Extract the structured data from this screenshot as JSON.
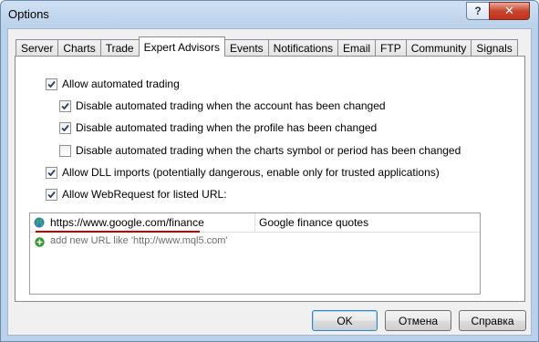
{
  "window": {
    "title": "Options",
    "help_label": "?",
    "close_label": "✕"
  },
  "tabs": [
    {
      "label": "Server"
    },
    {
      "label": "Charts"
    },
    {
      "label": "Trade"
    },
    {
      "label": "Expert Advisors",
      "active": true
    },
    {
      "label": "Events"
    },
    {
      "label": "Notifications"
    },
    {
      "label": "Email"
    },
    {
      "label": "FTP"
    },
    {
      "label": "Community"
    },
    {
      "label": "Signals"
    }
  ],
  "options": {
    "allow_automated": {
      "label": "Allow automated trading",
      "checked": true
    },
    "disable_account": {
      "label": "Disable automated trading when the account has been changed",
      "checked": true
    },
    "disable_profile": {
      "label": "Disable automated trading when the profile has been changed",
      "checked": true
    },
    "disable_symbol": {
      "label": "Disable automated trading when the charts symbol or period has been changed",
      "checked": false
    },
    "allow_dll": {
      "label": "Allow DLL imports (potentially dangerous, enable only for trusted applications)",
      "checked": true
    },
    "allow_webrequest": {
      "label": "Allow WebRequest for listed URL:",
      "checked": true
    }
  },
  "url_list": {
    "entries": [
      {
        "url": "https://www.google.com/finance",
        "description": "Google finance quotes",
        "icon": "globe-icon"
      }
    ],
    "add_hint": "add new URL like 'http://www.mql5.com'",
    "add_icon": "plus-circle-icon"
  },
  "buttons": {
    "ok": "OK",
    "cancel": "Отмена",
    "help": "Справка"
  },
  "colors": {
    "accent_underline": "#c00000",
    "add_icon": "#2e9a2e",
    "globe": "#2a7fc6"
  }
}
